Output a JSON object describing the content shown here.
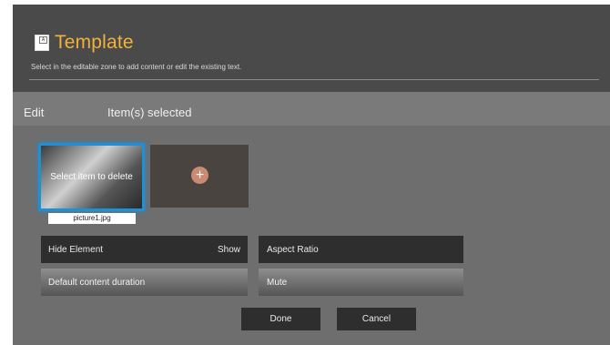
{
  "header": {
    "title": "Template",
    "subtitle": "Select in the editable zone to add content or edit the existing text."
  },
  "edit_bar": {
    "edit_label": "Edit",
    "selected_label": "Item(s) selected"
  },
  "items": {
    "selected_overlay": "Select item to delete",
    "filename": "picture1.jpg",
    "add_symbol": "+"
  },
  "options": {
    "hide_element_label": "Hide Element",
    "hide_element_value": "Show",
    "aspect_ratio_label": "Aspect Ratio",
    "default_duration_label": "Default content duration",
    "mute_label": "Mute"
  },
  "actions": {
    "done_label": "Done",
    "cancel_label": "Cancel"
  },
  "colors": {
    "accent": "#f1b23a",
    "selection": "#1f8fd6",
    "add_button": "#c98b73"
  }
}
